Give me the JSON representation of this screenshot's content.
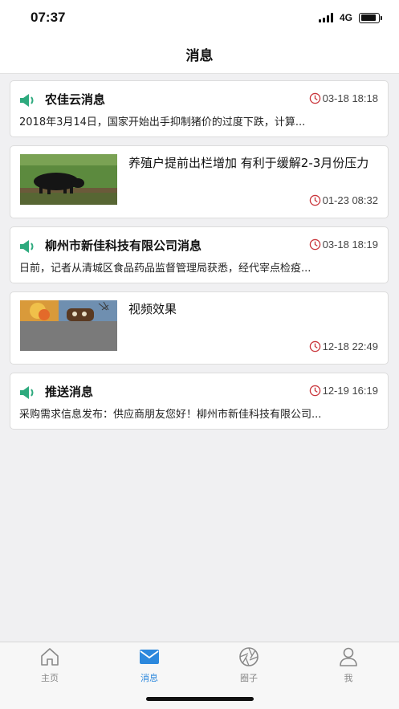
{
  "status_bar": {
    "time": "07:37",
    "network": "4G",
    "battery_level": 0.9
  },
  "header": {
    "title": "消息"
  },
  "colors": {
    "accent": "#2c88dd",
    "speaker": "#2eaa7e",
    "clock": "#c9343a"
  },
  "messages": [
    {
      "type": "text",
      "title": "农佳云消息",
      "time": "03-18 18:18",
      "summary": "2018年3月14日，国家开始出手抑制猪价的过度下跌，计算..."
    },
    {
      "type": "image",
      "title": "养殖户提前出栏增加 有利于缓解2-3月份压力",
      "time": "01-23 08:32",
      "image": "black-pig-on-grass"
    },
    {
      "type": "text",
      "title": "柳州市新佳科技有限公司消息",
      "time": "03-18 18:19",
      "summary": "日前，记者从清城区食品药品监督管理局获悉，经代宰点检疫..."
    },
    {
      "type": "image",
      "title": "视频效果",
      "time": "12-18 22:49",
      "image": "video-still-car-explosion"
    },
    {
      "type": "text",
      "title": "推送消息",
      "time": "12-19 16:19",
      "summary": "采购需求信息发布：供应商朋友您好！柳州市新佳科技有限公司..."
    }
  ],
  "tabs": [
    {
      "label": "主页",
      "icon": "home-icon",
      "active": false
    },
    {
      "label": "消息",
      "icon": "mail-icon",
      "active": true
    },
    {
      "label": "圈子",
      "icon": "aperture-icon",
      "active": false
    },
    {
      "label": "我",
      "icon": "person-icon",
      "active": false
    }
  ]
}
